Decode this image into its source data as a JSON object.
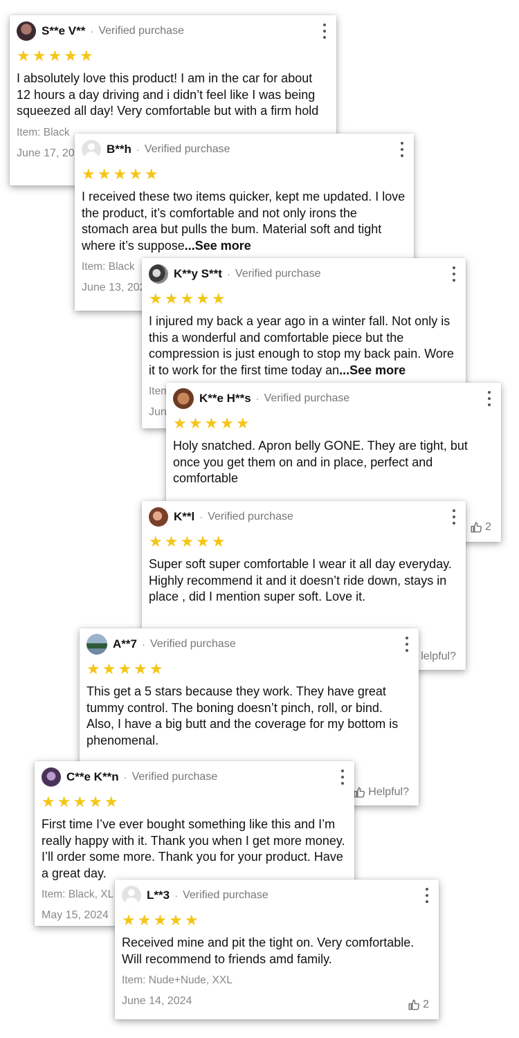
{
  "separator": "·",
  "reviews": [
    {
      "name": "S**e V**",
      "verified": "Verified purchase",
      "stars": "★★★★★",
      "text": "I absolutely love this product! I am in the car for about 12 hours a day driving and i didn’t feel like I was being squeezed all day! Very comfortable but with a firm hold",
      "item": "Item: Black",
      "date": "June 17, 2024"
    },
    {
      "name": "B**h",
      "verified": "Verified purchase",
      "stars": "★★★★★",
      "text": "I received these two items quicker, kept  me updated. I love the product, it’s comfortable and not only irons the stomach area but pulls the bum. Material soft and tight where it’s suppose",
      "see_more": "...See more",
      "item": "Item: Black",
      "date": "June 13, 2024"
    },
    {
      "name": "K**y S**t",
      "verified": "Verified purchase",
      "stars": "★★★★★",
      "text": "I injured my back a year ago in a winter fall. Not only is this a wonderful and comfortable piece but the compression is just enough to stop my back pain. Wore it to work for the first time today an",
      "see_more": "...See more",
      "item": "Item",
      "date": "June"
    },
    {
      "name": "K**e H**s",
      "verified": "Verified purchase",
      "stars": "★★★★★",
      "text": "Holy snatched. Apron belly GONE. They are tight, but once you get them on and in place, perfect and comfortable",
      "likes": "2"
    },
    {
      "name": "K**l",
      "verified": "Verified purchase",
      "stars": "★★★★★",
      "text": "Super soft super comfortable I wear it all day everyday. Highly recommend it and it doesn’t ride down, stays in place , did I mention super soft. Love it.",
      "helpful": "lelpful?"
    },
    {
      "name": "A**7",
      "verified": "Verified purchase",
      "stars": "★★★★★",
      "text": "This get a 5 stars because they work.  They have great tummy control. The boning doesn’t pinch, roll, or bind. Also,  I have a big butt and the coverage for my bottom is phenomenal.",
      "helpful": "Helpful?"
    },
    {
      "name": "C**e K**n",
      "verified": "Verified purchase",
      "stars": "★★★★★",
      "text": "First time I’ve ever bought something like this and I’m really happy with it. Thank you when I get more money. I’ll order some more. Thank you for your product. Have a great day.",
      "item": "Item: Black, XL",
      "date": "May 15, 2024"
    },
    {
      "name": "L**3",
      "verified": "Verified purchase",
      "stars": "★★★★★",
      "text": "Received mine and pit the tight on. Very comfortable. Will recommend to friends amd family.",
      "item": "Item: Nude+Nude, XXL",
      "date": "June 14, 2024",
      "likes": "2"
    }
  ]
}
